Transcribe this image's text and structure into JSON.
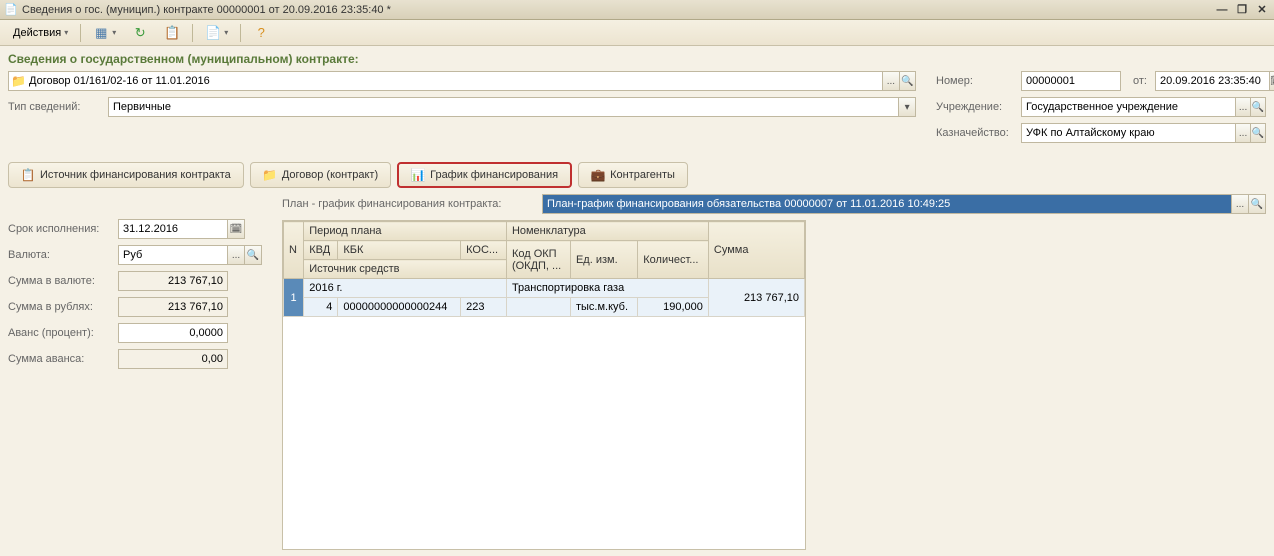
{
  "window": {
    "title": "Сведения о гос. (муницип.) контракте 00000001 от 20.09.2016 23:35:40 *"
  },
  "toolbar": {
    "actions": "Действия"
  },
  "section_title": "Сведения о государственном (муниципальном) контракте:",
  "main_doc": {
    "value": "Договор 01/161/02-16 от 11.01.2016"
  },
  "type_info": {
    "label": "Тип сведений:",
    "value": "Первичные"
  },
  "right": {
    "number_label": "Номер:",
    "number_value": "00000001",
    "date_label": "от:",
    "date_value": "20.09.2016 23:35:40",
    "org_label": "Учреждение:",
    "org_value": "Государственное учреждение",
    "treasury_label": "Казначейство:",
    "treasury_value": "УФК по Алтайскому краю"
  },
  "tabs": {
    "t1": "Источник финансирования контракта",
    "t2": "Договор (контракт)",
    "t3": "График финансирования",
    "t4": "Контрагенты"
  },
  "plan": {
    "label": "План - график финансирования контракта:",
    "value": "План-график финансирования обязательства 00000007 от 11.01.2016 10:49:25"
  },
  "summary": {
    "due_label": "Срок исполнения:",
    "due_value": "31.12.2016",
    "currency_label": "Валюта:",
    "currency_value": "Руб",
    "sum_currency_label": "Сумма в валюте:",
    "sum_currency_value": "213 767,10",
    "sum_rub_label": "Сумма в рублях:",
    "sum_rub_value": "213 767,10",
    "advance_pct_label": "Аванс (процент):",
    "advance_pct_value": "0,0000",
    "advance_sum_label": "Сумма аванса:",
    "advance_sum_value": "0,00"
  },
  "grid": {
    "headers": {
      "n": "N",
      "period": "Период плана",
      "nomen": "Номенклатура",
      "sum": "Сумма",
      "kvd": "КВД",
      "kbk": "КБК",
      "kos": "КОС...",
      "okp": "Код ОКП (ОКДП, ...",
      "unit": "Ед. изм.",
      "qty": "Количест...",
      "src": "Источник средств"
    },
    "rows": [
      {
        "n": "1",
        "period": "2016 г.",
        "kvd": "4",
        "kbk": "00000000000000244",
        "kos": "223",
        "okp": "",
        "nomen": "Транспортировка газа",
        "unit": "тыс.м.куб.",
        "qty": "190,000",
        "sum": "213 767,10"
      }
    ]
  }
}
